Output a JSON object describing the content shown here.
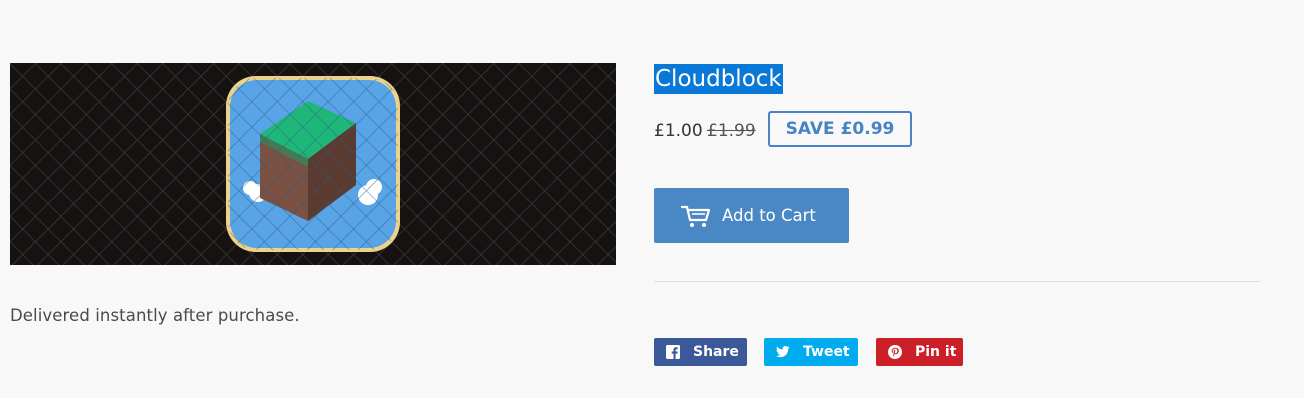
{
  "product": {
    "title": "Cloudblock",
    "price": "£1.00",
    "compare_price": "£1.99",
    "save_label": "SAVE £0.99",
    "add_to_cart_label": "Add to Cart",
    "description": "Delivered instantly after purchase.",
    "image_icon": "cloudblock-app-icon"
  },
  "share": {
    "facebook_label": "Share",
    "twitter_label": "Tweet",
    "pinterest_label": "Pin it"
  },
  "colors": {
    "selection_highlight": "#0a78d7",
    "accent_blue": "#4a88c5",
    "facebook": "#3b5998",
    "twitter": "#00aced",
    "pinterest": "#cb2027"
  }
}
